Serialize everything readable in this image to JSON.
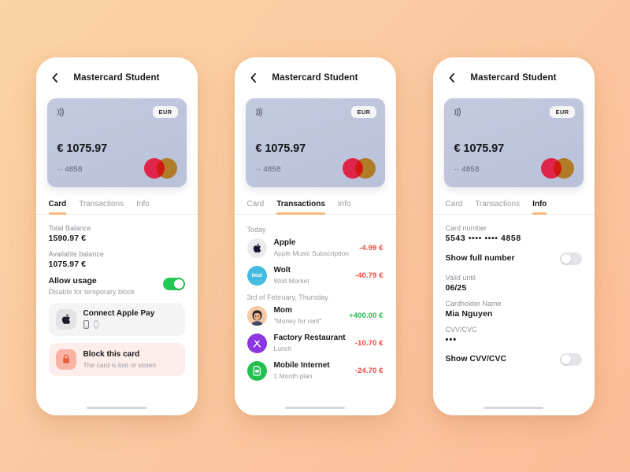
{
  "theme": {
    "bg_start": "#fcd3a4",
    "bg_end": "#fbbd97",
    "accent_underline": "#f5b97f",
    "toggle_on": "#21c954",
    "negative": "#f2453d",
    "positive": "#1fbf4c",
    "card_bg": "#c0c7dd"
  },
  "header": {
    "back_icon": "chevron-left-icon",
    "title": "Mastercard Student"
  },
  "bank_card": {
    "nfc_icon": "contactless-icon",
    "currency_badge": "EUR",
    "amount": "€ 1075.97",
    "masked_last4": "·· 4858",
    "brand_logo": "mastercard-logo"
  },
  "tabs": [
    {
      "label": "Card"
    },
    {
      "label": "Transactions"
    },
    {
      "label": "Info"
    }
  ],
  "screens": [
    {
      "active_tab": 0
    },
    {
      "active_tab": 1
    },
    {
      "active_tab": 2
    }
  ],
  "card_tab": {
    "total_balance_label": "Total Balance",
    "total_balance_value": "1590.97 €",
    "available_balance_label": "Available balance",
    "available_balance_value": "1075.97 €",
    "allow_usage_title": "Allow usage",
    "allow_usage_subtitle": "Disable for temporary block",
    "allow_usage_state": "on",
    "apple_pay": {
      "icon": "apple-logo-icon",
      "title": "Connect Apple Pay",
      "devices": [
        "iphone-icon",
        "apple-watch-icon"
      ]
    },
    "block_card": {
      "icon": "lock-icon",
      "title": "Block this card",
      "subtitle": "The card is lost or stolen"
    }
  },
  "transactions_tab": {
    "groups": [
      {
        "date": "Today",
        "items": [
          {
            "icon": "apple-logo-icon",
            "icon_bg": "#ebebed",
            "name": "Apple",
            "subtitle": "Apple Music Subscription",
            "amount": "-4.99 €",
            "sign": "neg"
          },
          {
            "icon": "wolt-logo-icon",
            "icon_bg": "#44bbe0",
            "name": "Wolt",
            "subtitle": "Wolt Market",
            "amount": "-40.79 €",
            "sign": "neg"
          }
        ]
      },
      {
        "date": "3rd of February, Thursday",
        "items": [
          {
            "icon": "avatar-photo-icon",
            "icon_bg": "#f2c4a0",
            "name": "Mom",
            "subtitle": "\"Money for rent\"",
            "amount": "+400.00 €",
            "sign": "pos"
          },
          {
            "icon": "cutlery-icon",
            "icon_bg": "#8b36e0",
            "name": "Factory Restaurant",
            "subtitle": "Lunch",
            "amount": "-10.70 €",
            "sign": "neg"
          },
          {
            "icon": "sim-card-icon",
            "icon_bg": "#23c050",
            "name": "Mobile Internet",
            "subtitle": "1 Month plan",
            "amount": "-24.70 €",
            "sign": "neg"
          }
        ]
      }
    ]
  },
  "info_tab": {
    "card_number_label": "Card number",
    "card_number_value": "5543 •••• •••• 4858",
    "show_full_number_label": "Show full number",
    "show_full_number_state": "off",
    "valid_until_label": "Valid until",
    "valid_until_value": "06/25",
    "cardholder_label": "Cardholder Name",
    "cardholder_value": "Mia Nguyen",
    "cvv_label": "CVV/CVC",
    "cvv_value": "•••",
    "show_cvv_label": "Show CVV/CVC",
    "show_cvv_state": "off"
  }
}
